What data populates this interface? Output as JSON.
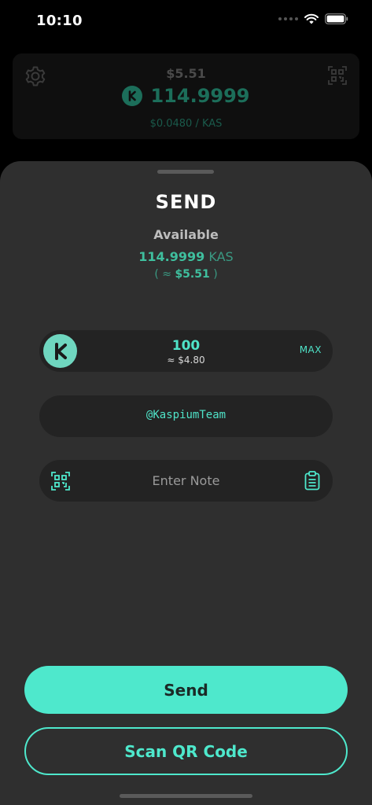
{
  "status_bar": {
    "time": "10:10"
  },
  "wallet": {
    "fiat_balance": "$5.51",
    "balance": "114.9999",
    "price": "$0.0480 / KAS",
    "icons": {
      "settings": "gear-icon",
      "scan": "qr-code-icon",
      "logo": "kaspa-logo-icon"
    }
  },
  "send_sheet": {
    "title": "SEND",
    "available_label": "Available",
    "available_amount": "114.9999",
    "available_unit": "KAS",
    "available_fiat_prefix": "( ≈",
    "available_fiat_value": "$5.51",
    "available_fiat_suffix": ")",
    "amount_value": "100",
    "amount_fiat": "≈ $4.80",
    "max_label": "MAX",
    "address_value": "@KaspiumTeam",
    "note_placeholder": "Enter Note",
    "send_label": "Send",
    "scan_label": "Scan QR Code"
  },
  "colors": {
    "accent": "#4ee8cc",
    "sheet_bg": "#2f2f2f",
    "field_bg": "#232323",
    "app_bg": "#000000"
  }
}
